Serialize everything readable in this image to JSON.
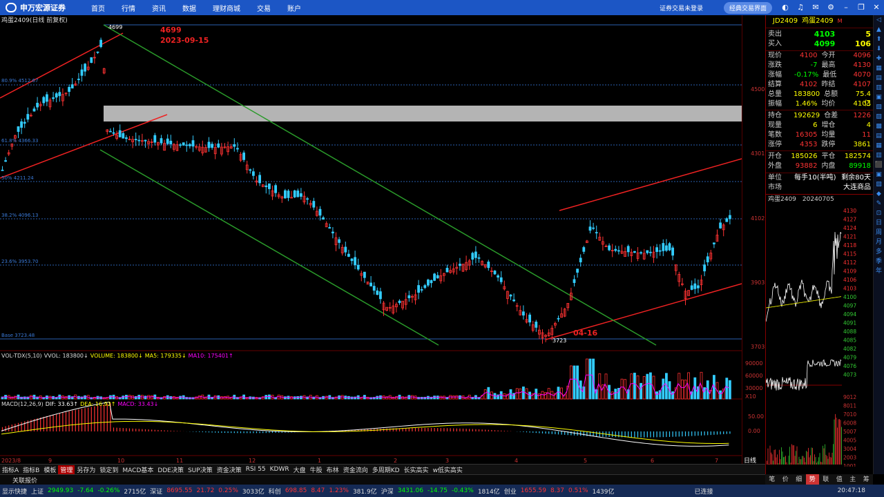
{
  "menu": {
    "brand": "申万宏源证券",
    "items": [
      "首页",
      "行情",
      "资讯",
      "数据",
      "理财商城",
      "交易",
      "账户"
    ],
    "login_status": "证券交易未登录",
    "classic_button": "经典交易界面"
  },
  "icons": [
    "theme-icon",
    "headset-icon",
    "mail-icon",
    "settings-icon",
    "minimize-icon",
    "restore-icon",
    "close-icon"
  ],
  "chart": {
    "symbol_title": "鸡蛋2409(日线 前复权)",
    "high_label": "4699",
    "high_annotation_price": "4699",
    "high_annotation_date": "2023-09-15",
    "low_label": "3723",
    "low_annotation_date": "04-16",
    "fib_labels": [
      "80.9% 4512.67",
      "61.8% 4366.33",
      "50% 4211.24",
      "38.2% 4096.13",
      "23.6% 3953.70",
      "Base 3723.48"
    ],
    "y_labels": [
      "4500",
      "4301",
      "4102",
      "3903",
      "3703"
    ],
    "vol_header": {
      "name": "VOL-TDX(5,10)",
      "vvol": "VVOL: 183800↓",
      "volume": "VOLUME: 183800↓",
      "ma5": "MA5: 179335↓",
      "ma10": "MA10: 175401↑"
    },
    "vol_y": [
      "90000",
      "60000",
      "30000",
      "X10"
    ],
    "macd_header": {
      "name": "MACD(12,26,9)",
      "dif": "DIF: 33.63↑",
      "dea": "DEA: 16.92↑",
      "macd": "MACD: 33.43↓"
    },
    "macd_y": [
      "50.00",
      "0.00"
    ],
    "x_labels": [
      "2023/8",
      "9",
      "10",
      "11",
      "12",
      "1",
      "2",
      "3",
      "4",
      "5",
      "6",
      "7"
    ],
    "period_label": "日线"
  },
  "quote": {
    "code": "JD2409",
    "name": "鸡蛋2409",
    "flag": "M",
    "ask_label": "卖出",
    "ask_price": "4103",
    "ask_vol": "5",
    "bid_label": "买入",
    "bid_price": "4099",
    "bid_vol": "106",
    "rows": [
      [
        "现价",
        "4100",
        "今开",
        "4096"
      ],
      [
        "涨跌",
        "-7",
        "最高",
        "4130"
      ],
      [
        "涨幅",
        "-0.17%",
        "最低",
        "4070"
      ],
      [
        "结算",
        "4102",
        "昨结",
        "4107"
      ],
      [
        "总量",
        "183800",
        "总额",
        "75.4亿"
      ],
      [
        "振幅",
        "1.46%",
        "均价",
        "4103"
      ],
      [
        "持仓",
        "192629",
        "仓差",
        "1226"
      ],
      [
        "现量",
        "6",
        "增仓",
        "4"
      ],
      [
        "笔数",
        "16305",
        "均量",
        "11"
      ],
      [
        "涨停",
        "4353",
        "跌停",
        "3861"
      ],
      [
        "开仓",
        "185026",
        "平仓",
        "182574"
      ],
      [
        "外盘",
        "93882",
        "内盘",
        "89918"
      ]
    ],
    "unit_label": "单位",
    "unit_value": "每手10(半吨)",
    "remain": "剩余80天",
    "market_label": "市场",
    "market_value": "大连商品"
  },
  "intraday": {
    "title": "鸡蛋2409",
    "date": "20240705",
    "prices": [
      "4130",
      "4127",
      "4124",
      "4121",
      "4118",
      "4115",
      "4112",
      "4109",
      "4106",
      "4103",
      "4100",
      "4097",
      "4094",
      "4091",
      "4088",
      "4085",
      "4082",
      "4079",
      "4076",
      "4073"
    ],
    "volumes": [
      "9012",
      "8011",
      "7010",
      "6008",
      "5007",
      "4005",
      "3004",
      "2003",
      "1001"
    ]
  },
  "right_strip": [
    "日",
    "周",
    "月",
    "多",
    "季",
    "年"
  ],
  "tabs": [
    "指标A",
    "指标B",
    "模板",
    "管理",
    "另存为",
    "锁定到",
    "MACD基本",
    "DDE决策",
    "SUP决策",
    "资金决策",
    "RSI 55",
    "KDWR",
    "大盘",
    "牛股",
    "布林",
    "资金流向",
    "多周期KD",
    "长实高实",
    "w低实高实"
  ],
  "tabs_active": "管理",
  "bottom_bar": "关联报价",
  "rp_tabs": [
    "笔",
    "价",
    "细",
    "势",
    "联",
    "值",
    "主",
    "筹"
  ],
  "rp_tabs_active": "势",
  "status": {
    "quick": "显示快捷",
    "sh_name": "上证",
    "sh": "2949.93",
    "sh_chg": "-7.64",
    "sh_pct": "-0.26%",
    "sh_amt": "2715亿",
    "sz_name": "深证",
    "sz": "8695.55",
    "sz_chg": "21.72",
    "sz_pct": "0.25%",
    "sz_amt": "3033亿",
    "kc_name": "科创",
    "kc": "698.85",
    "kc_chg": "8.47",
    "kc_pct": "1.23%",
    "kc_amt": "381.9亿",
    "hs_name": "沪深",
    "hs": "3431.06",
    "hs_chg": "-14.75",
    "hs_pct": "-0.43%",
    "hs_amt": "1814亿",
    "cy_name": "创业",
    "cy": "1655.59",
    "cy_chg": "8.37",
    "cy_pct": "0.51%",
    "cy_amt": "1439亿",
    "conn": "已连接",
    "time": "20:47:18"
  }
}
